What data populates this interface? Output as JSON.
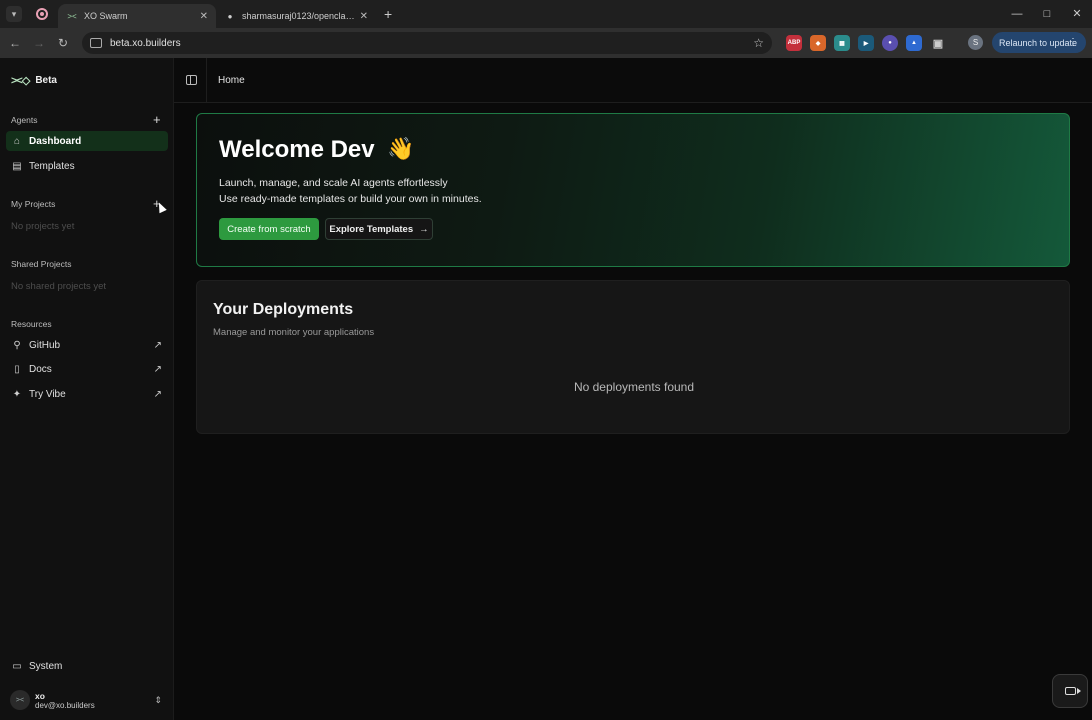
{
  "browser": {
    "tabs": [
      {
        "title": "XO Swarm",
        "favicon": "xo-logo-icon",
        "active": true
      },
      {
        "title": "sharmasuraj0123/openclaw-sta",
        "favicon": "github-icon",
        "active": false
      }
    ],
    "url": "beta.xo.builders",
    "profile_initial": "S",
    "relaunch_label": "Relaunch to update",
    "extensions": [
      "ABP",
      "fox",
      "grid",
      "play",
      "circle",
      "shield",
      "puzzle"
    ]
  },
  "sidebar": {
    "brand_logo": "><◇",
    "brand_name": "Beta",
    "agents_label": "Agents",
    "agents_items": [
      {
        "label": "Dashboard",
        "icon": "home-icon"
      },
      {
        "label": "Templates",
        "icon": "document-icon"
      }
    ],
    "my_projects_label": "My Projects",
    "my_projects_empty": "No projects yet",
    "shared_projects_label": "Shared Projects",
    "shared_projects_empty": "No shared projects yet",
    "resources_label": "Resources",
    "resources_items": [
      {
        "label": "GitHub",
        "icon": "github-icon"
      },
      {
        "label": "Docs",
        "icon": "book-icon"
      },
      {
        "label": "Try Vibe",
        "icon": "sparkle-icon"
      }
    ],
    "system_label": "System",
    "user": {
      "name": "xo",
      "email": "dev@xo.builders"
    }
  },
  "topbar": {
    "breadcrumb": "Home"
  },
  "hero": {
    "title": "Welcome Dev",
    "emoji": "👋",
    "line1": "Launch, manage, and scale AI agents effortlessly",
    "line2": "Use ready-made templates or build your own in minutes.",
    "primary_button": "Create from scratch",
    "secondary_button": "Explore Templates"
  },
  "deployments": {
    "title": "Your Deployments",
    "description": "Manage and monitor your applications",
    "empty": "No deployments found"
  },
  "colors": {
    "accent": "#2d9a3f",
    "hero_border": "#1f7a45",
    "relaunch_bg": "#24456e"
  }
}
